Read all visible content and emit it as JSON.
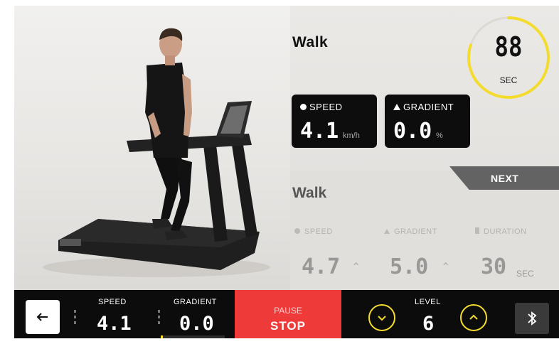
{
  "current": {
    "title": "Walk"
  },
  "timer": {
    "value": "88",
    "unit": "SEC",
    "progress": 0.8,
    "color": "#f3dc2d"
  },
  "cards": {
    "speed": {
      "label": "SPEED",
      "value": "4.1",
      "unit": "km/h",
      "icon": "speedometer-icon"
    },
    "gradient": {
      "label": "GRADIENT",
      "value": "0.0",
      "unit": "%",
      "icon": "mountain-icon"
    }
  },
  "next": {
    "button": "NEXT",
    "title": "Walk",
    "speed": {
      "label": "SPEED",
      "value": "4.7"
    },
    "gradient": {
      "label": "GRADIENT",
      "value": "5.0"
    },
    "duration": {
      "label": "DURATION",
      "value": "30",
      "unit": "SEC"
    }
  },
  "bar": {
    "speed": {
      "label": "SPEED",
      "value": "4.1"
    },
    "gradient": {
      "label": "GRADIENT",
      "value": "0.0"
    },
    "pause_label": "PAUSE",
    "stop_label": "STOP",
    "level": {
      "label": "LEVEL",
      "value": "6"
    }
  },
  "colors": {
    "accent": "#f3dc2d",
    "stop": "#ef3a3a",
    "bar": "#0c0c0c"
  }
}
